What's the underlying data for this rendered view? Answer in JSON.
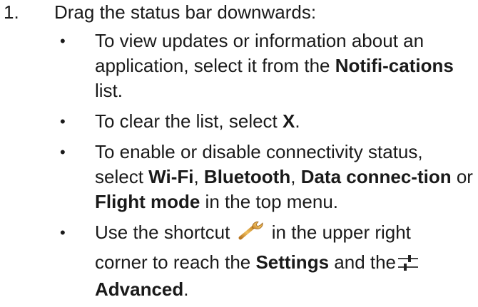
{
  "step": {
    "number": "1.",
    "text": "Drag the status bar downwards:"
  },
  "bullets": [
    {
      "marker": "•",
      "t1": "To view updates or information about an application, select it from the ",
      "b1": "Notifi-cations",
      "t2": " list."
    },
    {
      "marker": "•",
      "t1": "To clear the list, select ",
      "b1": "X",
      "t2": "."
    },
    {
      "marker": "•",
      "t1": "To enable or disable connectivity status, select ",
      "b1": "Wi-Fi",
      "t2": ", ",
      "b2": "Bluetooth",
      "t3": ", ",
      "b3": "Data connec-tion",
      "t4": " or ",
      "b4": "Flight mode",
      "t5": " in the top menu."
    },
    {
      "marker": "•",
      "t1": "Use the shortcut",
      "icon1": "wrench-icon",
      "t2": "in the upper right",
      "t3": "corner to reach the ",
      "b1": "Settings",
      "t4": " and the",
      "icon2": "sliders-icon",
      "b2": "Advanced",
      "t5": "."
    }
  ]
}
